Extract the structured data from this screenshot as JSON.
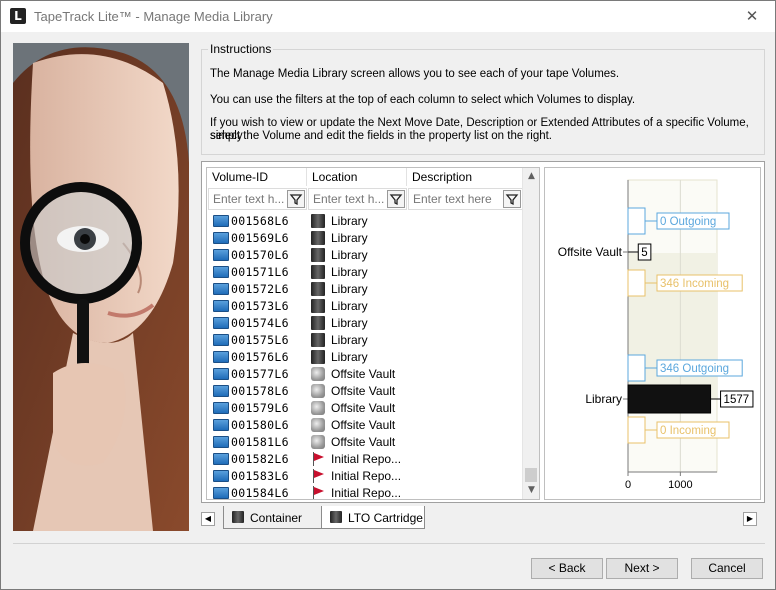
{
  "window": {
    "title": "TapeTrack Lite™ - Manage Media Library",
    "app_icon_letter": "L",
    "close_glyph": "✕"
  },
  "instructions": {
    "legend": "Instructions",
    "line1": "The Manage Media Library screen allows you to see each of your tape Volumes.",
    "line2": "You can use the filters at the top of each column to select which Volumes to display.",
    "line3a": "If you wish to view or update the Next Move Date, Description or Extended Attributes of a specific Volume, simply",
    "line3b": "select the Volume and edit the fields in the property list on the right."
  },
  "grid": {
    "columns": [
      {
        "label": "Volume-ID",
        "placeholder": "Enter text h..."
      },
      {
        "label": "Location",
        "placeholder": "Enter text h..."
      },
      {
        "label": "Description",
        "placeholder": "Enter text here"
      }
    ],
    "rows": [
      {
        "volume": "001568L6",
        "location": "Library",
        "icon": "library"
      },
      {
        "volume": "001569L6",
        "location": "Library",
        "icon": "library"
      },
      {
        "volume": "001570L6",
        "location": "Library",
        "icon": "library"
      },
      {
        "volume": "001571L6",
        "location": "Library",
        "icon": "library"
      },
      {
        "volume": "001572L6",
        "location": "Library",
        "icon": "library"
      },
      {
        "volume": "001573L6",
        "location": "Library",
        "icon": "library"
      },
      {
        "volume": "001574L6",
        "location": "Library",
        "icon": "library"
      },
      {
        "volume": "001575L6",
        "location": "Library",
        "icon": "library"
      },
      {
        "volume": "001576L6",
        "location": "Library",
        "icon": "library"
      },
      {
        "volume": "001577L6",
        "location": "Offsite Vault",
        "icon": "vault"
      },
      {
        "volume": "001578L6",
        "location": "Offsite Vault",
        "icon": "vault"
      },
      {
        "volume": "001579L6",
        "location": "Offsite Vault",
        "icon": "vault"
      },
      {
        "volume": "001580L6",
        "location": "Offsite Vault",
        "icon": "vault"
      },
      {
        "volume": "001581L6",
        "location": "Offsite Vault",
        "icon": "vault"
      },
      {
        "volume": "001582L6",
        "location": "Initial Repo...",
        "icon": "flag"
      },
      {
        "volume": "001583L6",
        "location": "Initial Repo...",
        "icon": "flag"
      },
      {
        "volume": "001584L6",
        "location": "Initial Repo...",
        "icon": "flag"
      }
    ],
    "scroll_up": "▲",
    "scroll_down": "▼"
  },
  "chart_data": {
    "type": "bar",
    "orientation": "horizontal",
    "categories": [
      "Offsite Vault",
      "Library"
    ],
    "x_ticks": [
      0,
      1000
    ],
    "xlim": [
      0,
      1700
    ],
    "groups": [
      {
        "category": "Offsite Vault",
        "bars": [
          {
            "label": "0 Outgoing",
            "value": 0,
            "color": "#5ba7dd",
            "kind": "outgoing"
          },
          {
            "label": "5",
            "value": 5,
            "color": "#000000",
            "kind": "current"
          },
          {
            "label": "346 Incoming",
            "value": 0,
            "color": "#e8c16a",
            "kind": "incoming"
          }
        ]
      },
      {
        "category": "Library",
        "bars": [
          {
            "label": "346 Outgoing",
            "value": 0,
            "color": "#5ba7dd",
            "kind": "outgoing"
          },
          {
            "label": "1577",
            "value": 1577,
            "color": "#000000",
            "kind": "current"
          },
          {
            "label": "0 Incoming",
            "value": 0,
            "color": "#e8c16a",
            "kind": "incoming"
          }
        ]
      }
    ]
  },
  "tabs": {
    "items": [
      {
        "label": "Container"
      },
      {
        "label": "LTO Cartridge"
      }
    ],
    "left_arrow": "◀",
    "right_arrow": "▶"
  },
  "buttons": {
    "back": "< Back",
    "next": "Next >",
    "cancel": "Cancel"
  }
}
